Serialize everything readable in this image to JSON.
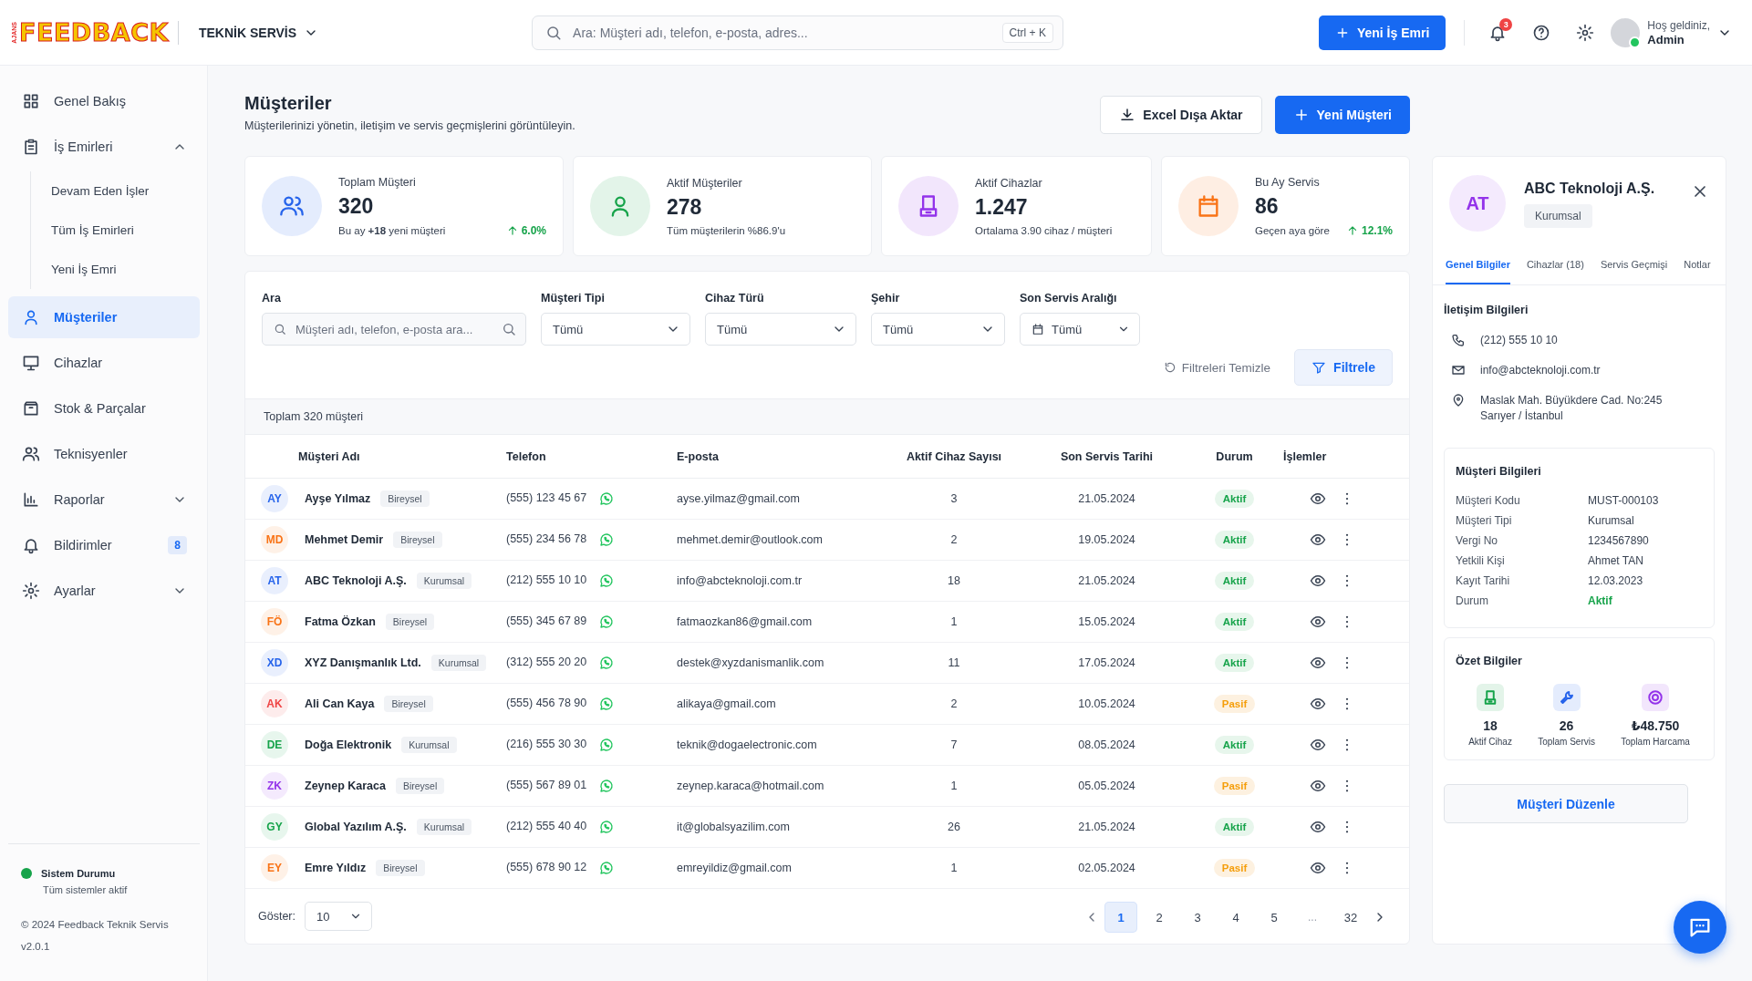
{
  "topbar": {
    "logo_tag": "AJANS",
    "logo": "FEEDBACK",
    "workspace": "TEKNİK SERVİS",
    "search": {
      "placeholder": "Ara: Müşteri adı, telefon, e-posta, adres...",
      "shortcut": "Ctrl + K"
    },
    "new_button": "Yeni İş Emri",
    "notification_count": "3",
    "greeting": "Hoş geldiniz,",
    "user": "Admin"
  },
  "sidebar": {
    "items": [
      {
        "label": "Genel Bakış",
        "selected": false
      },
      {
        "label": "İş Emirleri",
        "selected": false,
        "expanded": true,
        "children": [
          {
            "label": "Devam Eden İşler",
            "selected": false
          },
          {
            "label": "Tüm İş Emirleri",
            "selected": false
          },
          {
            "label": "Yeni İş Emri",
            "selected": false
          }
        ]
      },
      {
        "label": "Müşteriler",
        "selected": true
      },
      {
        "label": "Cihazlar",
        "selected": false
      },
      {
        "label": "Stok & Parçalar",
        "selected": false
      },
      {
        "label": "Teknisyenler",
        "selected": false
      },
      {
        "label": "Raporlar",
        "selected": false,
        "expanded": false
      },
      {
        "label": "Bildirimler",
        "selected": false,
        "badge": "8"
      },
      {
        "label": "Ayarlar",
        "selected": false,
        "expanded": false
      }
    ],
    "status_title": "Sistem Durumu",
    "status_text": "Tüm sistemler aktif",
    "copyright": "© 2024 Feedback Teknik Servis",
    "version": "v2.0.1"
  },
  "page": {
    "title": "Müşteriler",
    "subtitle": "Müşterilerinizi yönetin, iletişim ve servis geçmişlerini görüntüleyin.",
    "buttons": [
      {
        "label": "Excel Dışa Aktar",
        "kind": "secondary"
      },
      {
        "label": "Yeni Müşteri",
        "kind": "primary"
      }
    ]
  },
  "stats": [
    {
      "title": "Toplam Müşteri",
      "value": "320",
      "note": "Bu ay **+18** yeni müşteri",
      "trend": "6.0%",
      "color": "#2563eb"
    },
    {
      "title": "Aktif Müşteriler",
      "value": "278",
      "note": "Tüm müşterilerin %86.9'u",
      "color": "#16a34a"
    },
    {
      "title": "Aktif Cihazlar",
      "value": "1.247",
      "note": "Ortalama 3.90 cihaz / müşteri",
      "color": "#9333ea"
    },
    {
      "title": "Bu Ay Servis",
      "value": "86",
      "note": "Geçen aya göre",
      "trend": "12.1%",
      "color": "#f97316"
    }
  ],
  "filters": {
    "fields": [
      {
        "label": "Ara",
        "kind": "search",
        "placeholder": "Müşteri adı, telefon, e-posta ara..."
      },
      {
        "label": "Müşteri Tipi",
        "kind": "select",
        "value": "Tümü"
      },
      {
        "label": "Cihaz Türü",
        "kind": "select",
        "value": "Tümü"
      },
      {
        "label": "Şehir",
        "kind": "select",
        "value": "Tümü"
      },
      {
        "label": "Son Servis Aralığı",
        "kind": "date",
        "value": "Tümü"
      }
    ],
    "clear": "Filtreleri Temizle",
    "apply": "Filtrele"
  },
  "table": {
    "total": "Toplam 320 müşteri",
    "columns": [
      "Müşteri Adı",
      "Telefon",
      "E-posta",
      "Aktif Cihaz Sayısı",
      "Son Servis Tarihi",
      "Durum",
      "İşlemler"
    ],
    "rows": [
      {
        "initials": "AY",
        "color": "#2563eb",
        "name": "Ayşe Yılmaz",
        "type": "Bireysel",
        "phone": "(555) 123 45 67",
        "email": "ayse.yilmaz@gmail.com",
        "devices": "3",
        "last_service": "21.05.2024",
        "status": "Aktif",
        "active": true
      },
      {
        "initials": "MD",
        "color": "#f97316",
        "name": "Mehmet Demir",
        "type": "Bireysel",
        "phone": "(555) 234 56 78",
        "email": "mehmet.demir@outlook.com",
        "devices": "2",
        "last_service": "19.05.2024",
        "status": "Aktif",
        "active": true
      },
      {
        "initials": "AT",
        "color": "#2563eb",
        "name": "ABC Teknoloji A.Ş.",
        "type": "Kurumsal",
        "phone": "(212) 555 10 10",
        "email": "info@abcteknoloji.com.tr",
        "devices": "18",
        "last_service": "21.05.2024",
        "status": "Aktif",
        "active": true
      },
      {
        "initials": "FÖ",
        "color": "#f97316",
        "name": "Fatma Özkan",
        "type": "Bireysel",
        "phone": "(555) 345 67 89",
        "email": "fatmaozkan86@gmail.com",
        "devices": "1",
        "last_service": "15.05.2024",
        "status": "Aktif",
        "active": true
      },
      {
        "initials": "XD",
        "color": "#2563eb",
        "name": "XYZ Danışmanlık Ltd.",
        "type": "Kurumsal",
        "phone": "(312) 555 20 20",
        "email": "destek@xyzdanismanlik.com",
        "devices": "11",
        "last_service": "17.05.2024",
        "status": "Aktif",
        "active": true
      },
      {
        "initials": "AK",
        "color": "#ef4444",
        "name": "Ali Can Kaya",
        "type": "Bireysel",
        "phone": "(555) 456 78 90",
        "email": "alikaya@gmail.com",
        "devices": "2",
        "last_service": "10.05.2024",
        "status": "Pasif",
        "active": false
      },
      {
        "initials": "DE",
        "color": "#16a34a",
        "name": "Doğa Elektronik",
        "type": "Kurumsal",
        "phone": "(216) 555 30 30",
        "email": "teknik@dogaelectronic.com",
        "devices": "7",
        "last_service": "08.05.2024",
        "status": "Aktif",
        "active": true
      },
      {
        "initials": "ZK",
        "color": "#9333ea",
        "name": "Zeynep Karaca",
        "type": "Bireysel",
        "phone": "(555) 567 89 01",
        "email": "zeynep.karaca@hotmail.com",
        "devices": "1",
        "last_service": "05.05.2024",
        "status": "Pasif",
        "active": false
      },
      {
        "initials": "GY",
        "color": "#16a34a",
        "name": "Global Yazılım A.Ş.",
        "type": "Kurumsal",
        "phone": "(212) 555 40 40",
        "email": "it@globalsyazilim.com",
        "devices": "26",
        "last_service": "21.05.2024",
        "status": "Aktif",
        "active": true
      },
      {
        "initials": "EY",
        "color": "#f97316",
        "name": "Emre Yıldız",
        "type": "Bireysel",
        "phone": "(555) 678 90 12",
        "email": "emreyildiz@gmail.com",
        "devices": "1",
        "last_service": "02.05.2024",
        "status": "Pasif",
        "active": false
      }
    ]
  },
  "pagination": {
    "show_label": "Göster:",
    "page_size": "10",
    "pages": [
      {
        "label": "1",
        "kind": "page",
        "selected": true
      },
      {
        "label": "2",
        "kind": "page",
        "selected": false
      },
      {
        "label": "3",
        "kind": "page",
        "selected": false
      },
      {
        "label": "4",
        "kind": "page",
        "selected": false
      },
      {
        "label": "5",
        "kind": "page",
        "selected": false
      },
      {
        "label": "...",
        "kind": "gap"
      },
      {
        "label": "32",
        "kind": "page",
        "selected": false
      }
    ]
  },
  "panel": {
    "initials": "AT",
    "color": "#9333ea",
    "name": "ABC Teknoloji A.Ş.",
    "type": "Kurumsal",
    "tabs": [
      {
        "label": "Genel Bilgiler",
        "selected": true
      },
      {
        "label": "Cihazlar (18)",
        "selected": false
      },
      {
        "label": "Servis Geçmişi",
        "selected": false
      },
      {
        "label": "Notlar",
        "selected": false
      }
    ],
    "contact": {
      "title": "İletişim Bilgileri",
      "items": [
        {
          "kind": "phone",
          "lines": [
            "(212) 555 10 10"
          ]
        },
        {
          "kind": "email",
          "lines": [
            "info@abcteknoloji.com.tr"
          ]
        },
        {
          "kind": "address",
          "lines": [
            "Maslak Mah. Büyükdere Cad. No:245",
            "Sarıyer / İstanbul"
          ]
        }
      ]
    },
    "info": {
      "title": "Müşteri Bilgileri",
      "rows": [
        {
          "label": "Müşteri Kodu",
          "value": "MUST-000103",
          "kind": "text"
        },
        {
          "label": "Müşteri Tipi",
          "value": "Kurumsal",
          "kind": "text"
        },
        {
          "label": "Vergi No",
          "value": "1234567890",
          "kind": "text"
        },
        {
          "label": "Yetkili Kişi",
          "value": "Ahmet TAN",
          "kind": "text"
        },
        {
          "label": "Kayıt Tarihi",
          "value": "12.03.2023",
          "kind": "text"
        },
        {
          "label": "Durum",
          "value": "Aktif",
          "kind": "status"
        }
      ]
    },
    "summary": {
      "title": "Özet Bilgiler",
      "items": [
        {
          "value": "18",
          "label": "Aktif Cihaz",
          "color": "#16a34a"
        },
        {
          "value": "26",
          "label": "Toplam Servis",
          "color": "#2563eb"
        },
        {
          "value": "₺48.750",
          "label": "Toplam Harcama",
          "color": "#9333ea"
        }
      ]
    },
    "edit_button": "Müşteri Düzenle"
  }
}
